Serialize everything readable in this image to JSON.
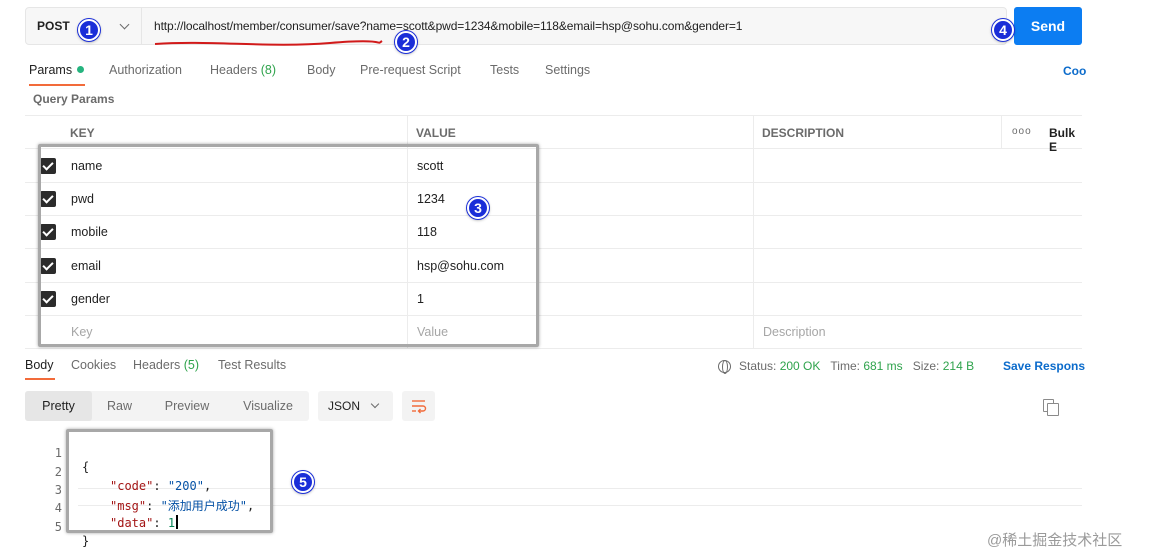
{
  "request": {
    "method": "POST",
    "url": "http://localhost/member/consumer/save?name=scott&pwd=1234&mobile=118&email=hsp@sohu.com&gender=1",
    "send_label": "Send"
  },
  "request_tabs": {
    "params": "Params",
    "authorization": "Authorization",
    "headers": "Headers",
    "headers_count": "(8)",
    "body": "Body",
    "prerequest": "Pre-request Script",
    "tests": "Tests",
    "settings": "Settings",
    "cookies_link": "Coo"
  },
  "query_params": {
    "title": "Query Params",
    "columns": {
      "key": "KEY",
      "value": "VALUE",
      "description": "DESCRIPTION",
      "more": "ooo",
      "bulk": "Bulk E"
    },
    "rows": [
      {
        "key": "name",
        "value": "scott"
      },
      {
        "key": "pwd",
        "value": "1234"
      },
      {
        "key": "mobile",
        "value": "118"
      },
      {
        "key": "email",
        "value": "hsp@sohu.com"
      },
      {
        "key": "gender",
        "value": "1"
      }
    ],
    "placeholder": {
      "key": "Key",
      "value": "Value",
      "description": "Description"
    }
  },
  "response_tabs": {
    "body": "Body",
    "cookies": "Cookies",
    "headers": "Headers",
    "headers_count": "(5)",
    "test_results": "Test Results"
  },
  "response_status": {
    "status_label": "Status:",
    "status": "200 OK",
    "time_label": "Time:",
    "time": "681 ms",
    "size_label": "Size:",
    "size": "214 B",
    "save_response": "Save Respons"
  },
  "view_modes": {
    "pretty": "Pretty",
    "raw": "Raw",
    "preview": "Preview",
    "visualize": "Visualize",
    "format": "JSON"
  },
  "response_body": {
    "line_numbers": [
      "1",
      "2",
      "3",
      "4",
      "5"
    ],
    "open_brace": "{",
    "close_brace": "}",
    "code_key": "\"code\"",
    "code_value": "\"200\"",
    "msg_key": "\"msg\"",
    "msg_value": "\"添加用户成功\"",
    "data_key": "\"data\"",
    "data_value": "1"
  },
  "annotations": [
    "1",
    "2",
    "3",
    "4",
    "5"
  ],
  "watermark": "@稀土掘金技术社区",
  "colors": {
    "accent": "#f26b3a",
    "send": "#0c7df2",
    "link": "#0b6bcb",
    "badge": "#1a2ed8",
    "success": "#2fa34c"
  }
}
